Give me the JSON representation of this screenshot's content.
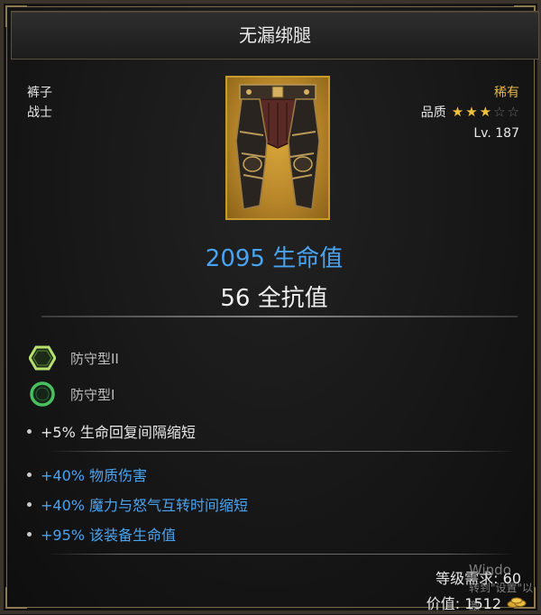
{
  "item": {
    "name": "无漏绑腿",
    "slot": "裤子",
    "class": "战士",
    "rarity": "稀有",
    "quality_label": "品质",
    "stars": {
      "filled": 3,
      "total": 5
    },
    "level": "Lv. 187",
    "image_icon": "legs-armor-icon"
  },
  "main_stats": {
    "hp": "2095 生命值",
    "resist": "56 全抗值"
  },
  "sockets": [
    {
      "icon": "hexagon-gem-icon",
      "label": "防守型II"
    },
    {
      "icon": "circle-gem-icon",
      "label": "防守型I"
    }
  ],
  "implicit": [
    "+5% 生命回复间隔缩短"
  ],
  "affixes": [
    "+40% 物质伤害",
    "+40% 魔力与怒气互转时间缩短",
    "+95% 该装备生命值"
  ],
  "footer": {
    "requirement": "等级需求: 60",
    "price": "价值: 1512",
    "watermark_line1": "Windo",
    "watermark_line2": "转到\"设置\"以激"
  },
  "colors": {
    "accent_blue": "#4aa3f0",
    "rarity_gold": "#e6b84c",
    "frame_gold": "#8c7a52"
  }
}
